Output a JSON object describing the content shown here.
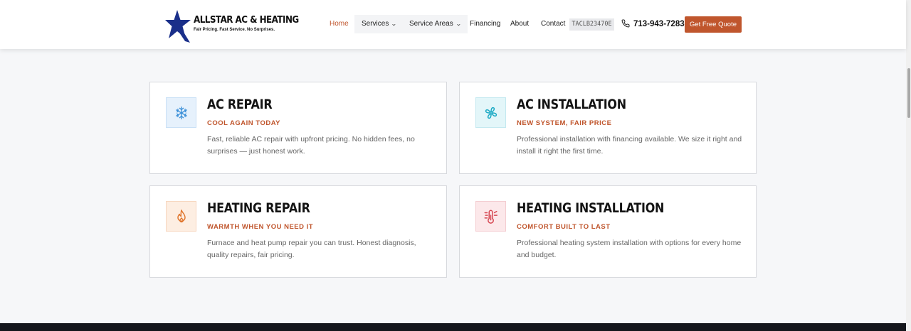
{
  "header": {
    "logo": {
      "name": "ALLSTAR AC & HEATING",
      "tagline": "Fair Pricing. Fast Service. No Surprises."
    },
    "nav": {
      "home": "Home",
      "services": "Services",
      "service_areas": "Service Areas",
      "financing": "Financing",
      "about": "About",
      "contact": "Contact"
    },
    "code": "TACLB23470E",
    "phone": "713-943-7283",
    "cta": "Get Free Quote"
  },
  "services": [
    {
      "title": "AC REPAIR",
      "subtitle": "COOL AGAIN TODAY",
      "description": "Fast, reliable AC repair with upfront pricing. No hidden fees, no surprises — just honest work.",
      "icon": "snowflake-icon",
      "icon_color": "#3a8fd8",
      "icon_bg": "#e6f1fc"
    },
    {
      "title": "AC INSTALLATION",
      "subtitle": "NEW SYSTEM, FAIR PRICE",
      "description": "Professional installation with financing available. We size it right and install it right the first time.",
      "icon": "fan-icon",
      "icon_color": "#1aa9c4",
      "icon_bg": "#e3f6f9"
    },
    {
      "title": "HEATING REPAIR",
      "subtitle": "WARMTH WHEN YOU NEED IT",
      "description": "Furnace and heat pump repair you can trust. Honest diagnosis, quality repairs, fair pricing.",
      "icon": "flame-icon",
      "icon_color": "#e0742a",
      "icon_bg": "#fdeee2"
    },
    {
      "title": "HEATING INSTALLATION",
      "subtitle": "COMFORT BUILT TO LAST",
      "description": "Professional heating system installation with options for every home and budget.",
      "icon": "thermometer-icon",
      "icon_color": "#d64550",
      "icon_bg": "#fce8ea"
    }
  ],
  "colors": {
    "accent": "#c0562d",
    "logo_star": "#1a2f8a"
  }
}
